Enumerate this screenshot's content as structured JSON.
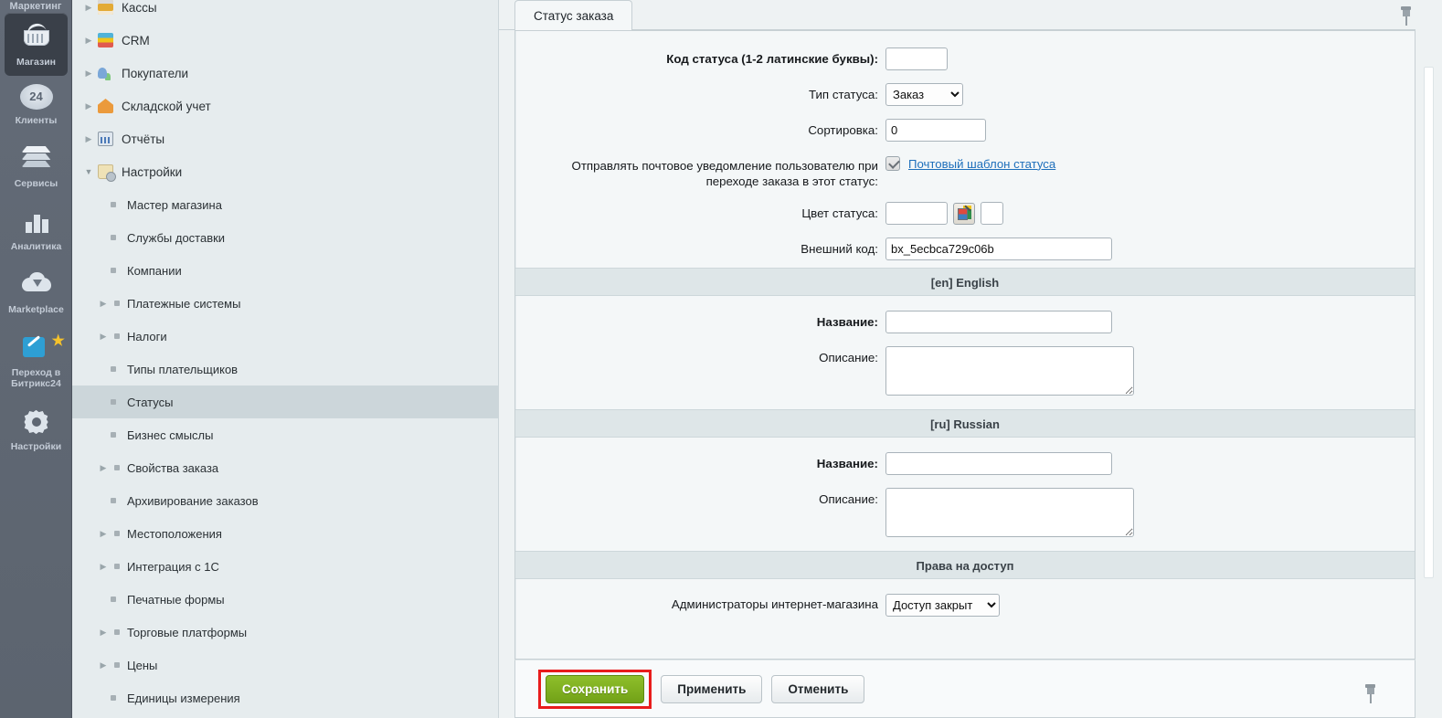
{
  "rail": {
    "partial_top_label": "Маркетинг",
    "items": [
      {
        "label": "Магазин",
        "icon": "basket-icon",
        "active": true
      },
      {
        "label": "Клиенты",
        "icon": "clients-24-icon",
        "active": false,
        "badge": "24"
      },
      {
        "label": "Сервисы",
        "icon": "layers-icon",
        "active": false
      },
      {
        "label": "Аналитика",
        "icon": "bar-chart-icon",
        "active": false
      },
      {
        "label": "Marketplace",
        "icon": "cloud-download-icon",
        "active": false
      },
      {
        "label": "Переход в\nБитрикс24",
        "icon": "magic-wand-icon",
        "active": false
      },
      {
        "label": "Настройки",
        "icon": "gear-icon",
        "active": false
      }
    ]
  },
  "tree": {
    "items": [
      {
        "label": "Кассы",
        "twisty": "collapsed",
        "icon": "cash-register-icon",
        "level": 0,
        "active": false
      },
      {
        "label": "CRM",
        "twisty": "collapsed",
        "icon": "crm-funnel-icon",
        "level": 0,
        "active": false
      },
      {
        "label": "Покупатели",
        "twisty": "collapsed",
        "icon": "buyers-icon",
        "level": 0,
        "active": false
      },
      {
        "label": "Складской учет",
        "twisty": "collapsed",
        "icon": "warehouse-icon",
        "level": 0,
        "active": false
      },
      {
        "label": "Отчёты",
        "twisty": "collapsed",
        "icon": "reports-icon",
        "level": 0,
        "active": false
      },
      {
        "label": "Настройки",
        "twisty": "expanded",
        "icon": "settings-bag-icon",
        "level": 0,
        "active": false
      },
      {
        "label": "Мастер магазина",
        "twisty": "none",
        "icon": "bullet",
        "level": 1,
        "active": false
      },
      {
        "label": "Службы доставки",
        "twisty": "none",
        "icon": "bullet",
        "level": 1,
        "active": false
      },
      {
        "label": "Компании",
        "twisty": "none",
        "icon": "bullet",
        "level": 1,
        "active": false
      },
      {
        "label": "Платежные системы",
        "twisty": "collapsed",
        "icon": "none",
        "level": 1,
        "active": false
      },
      {
        "label": "Налоги",
        "twisty": "collapsed",
        "icon": "none",
        "level": 1,
        "active": false
      },
      {
        "label": "Типы плательщиков",
        "twisty": "none",
        "icon": "bullet",
        "level": 1,
        "active": false
      },
      {
        "label": "Статусы",
        "twisty": "none",
        "icon": "bullet",
        "level": 1,
        "active": true
      },
      {
        "label": "Бизнес смыслы",
        "twisty": "none",
        "icon": "bullet",
        "level": 1,
        "active": false
      },
      {
        "label": "Свойства заказа",
        "twisty": "collapsed",
        "icon": "none",
        "level": 1,
        "active": false
      },
      {
        "label": "Архивирование заказов",
        "twisty": "none",
        "icon": "bullet",
        "level": 1,
        "active": false
      },
      {
        "label": "Местоположения",
        "twisty": "collapsed",
        "icon": "none",
        "level": 1,
        "active": false
      },
      {
        "label": "Интеграция с 1С",
        "twisty": "collapsed",
        "icon": "none",
        "level": 1,
        "active": false
      },
      {
        "label": "Печатные формы",
        "twisty": "none",
        "icon": "bullet",
        "level": 1,
        "active": false
      },
      {
        "label": "Торговые платформы",
        "twisty": "collapsed",
        "icon": "none",
        "level": 1,
        "active": false
      },
      {
        "label": "Цены",
        "twisty": "collapsed",
        "icon": "none",
        "level": 1,
        "active": false
      },
      {
        "label": "Единицы измерения",
        "twisty": "none",
        "icon": "bullet",
        "level": 1,
        "active": false
      }
    ]
  },
  "content": {
    "tab_label": "Статус заказа",
    "fields": {
      "code_label": "Код статуса (1-2 латинские буквы):",
      "code_value": "",
      "type_label": "Тип статуса:",
      "type_value": "Заказ",
      "type_options": [
        "Заказ"
      ],
      "sort_label": "Сортировка:",
      "sort_value": "0",
      "notify_label": "Отправлять почтовое уведомление пользователю при переходе заказа в этот статус:",
      "notify_checked": true,
      "notify_link": "Почтовый шаблон статуса",
      "color_label": "Цвет статуса:",
      "color_value": "",
      "ext_label": "Внешний код:",
      "ext_value": "bx_5ecbca729c06b"
    },
    "sections": [
      {
        "header": "[en] English",
        "name_label": "Название:",
        "name_value": "",
        "desc_label": "Описание:",
        "desc_value": ""
      },
      {
        "header": "[ru] Russian",
        "name_label": "Название:",
        "name_value": "",
        "desc_label": "Описание:",
        "desc_value": ""
      }
    ],
    "access": {
      "header": "Права на доступ",
      "row_label": "Администраторы интернет-магазина",
      "value": "Доступ закрыт",
      "options": [
        "Доступ закрыт"
      ]
    },
    "buttons": {
      "save": "Сохранить",
      "apply": "Применить",
      "cancel": "Отменить"
    },
    "highlight_color": "#e81c1c",
    "accent_color": "#7aaa1b"
  }
}
